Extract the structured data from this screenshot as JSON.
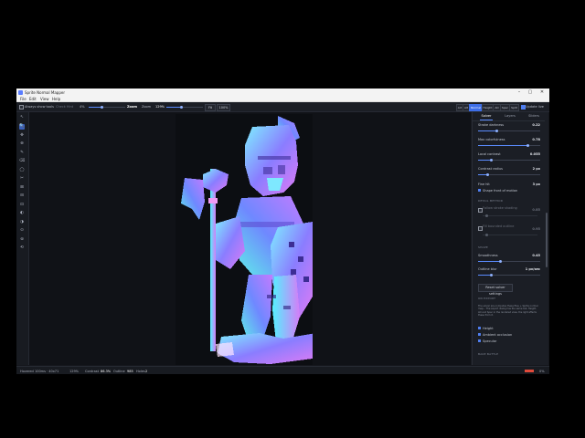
{
  "window": {
    "title": "Sprite Normal Mapper",
    "controls": [
      "–",
      "▢",
      "✕"
    ]
  },
  "menu": [
    "File",
    "Edit",
    "View",
    "Help"
  ],
  "toolbar": {
    "always_show_tools": "Always show tools",
    "check_text": "Check Hint",
    "brush_size_value": "4%",
    "zoom_label": "Zoom",
    "zoom_value_label": "Zoom",
    "zoom_value": "129%",
    "fit_button": "Fit",
    "reset_button": "100%",
    "view_tabs": [
      "Art",
      "Alt",
      "Normal",
      "Height",
      "AO",
      "Spec",
      "Split"
    ],
    "active_view": "Normal",
    "update_live_label": "Update live",
    "update_live_checked": true
  },
  "tools": [
    "↖",
    "🔍",
    "✥",
    "⊕",
    "✎",
    "⌫",
    "◯",
    "✂",
    "⊞",
    "⊟",
    "⊡",
    "◐",
    "◑",
    "⊙",
    "⊚",
    "⟲"
  ],
  "active_tool_index": 1,
  "right_panel": {
    "tabs": [
      "Solver",
      "Layers",
      "Sliders"
    ],
    "active_tab": "Solver",
    "params": [
      {
        "label": "Stroke darkness",
        "value": "0.22",
        "fraction": 0.3
      },
      {
        "label": "Max colorfulness",
        "value": "0.78",
        "fraction": 0.8
      },
      {
        "label": "Local contrast",
        "value": "0.055",
        "fraction": 0.2
      },
      {
        "label": "Contrast radius",
        "value": "2 px",
        "fraction": 0.15
      }
    ],
    "fine_hit": {
      "label": "Fine hit",
      "value": "3 px"
    },
    "shape_check": {
      "label": "Shape front of motion",
      "checked": true
    },
    "detail_section": "DETAIL METHOD",
    "detail_params": [
      {
        "label": "Follow stroke shading",
        "value": "0.85"
      },
      {
        "label": "Fill bounded outline",
        "value": "0.95"
      }
    ],
    "shape_section": "SHAPE",
    "shape_params": [
      {
        "label": "Smoothness",
        "value": "0.45",
        "fraction": 0.35
      },
      {
        "label": "Outline blur",
        "value": "1 px/sec",
        "fraction": 0.2
      }
    ],
    "reset_button": "Reset solver settings",
    "export_section": "ON EXPORT",
    "export_desc": "The solver pre-computes these files + Sprite normal map... The export dialog has the same tab. Height, AO and Spec in the rendered view, the light affects these from it.",
    "export_checks": [
      {
        "label": "Height",
        "checked": true
      },
      {
        "label": "Ambient occlusion",
        "checked": true
      },
      {
        "label": "Specular",
        "checked": true
      }
    ],
    "bake_section": "BAKE BATTLE"
  },
  "status": {
    "file_label": "Hovered",
    "file_value": "100ms · 40x71",
    "zoom": "129%",
    "contrast_label": "Contrast",
    "contrast_value": "86.3%",
    "outline_label": "Outline",
    "outline_value": "985",
    "holes_label": "Holes",
    "holes_value": "2",
    "right": "0%"
  }
}
